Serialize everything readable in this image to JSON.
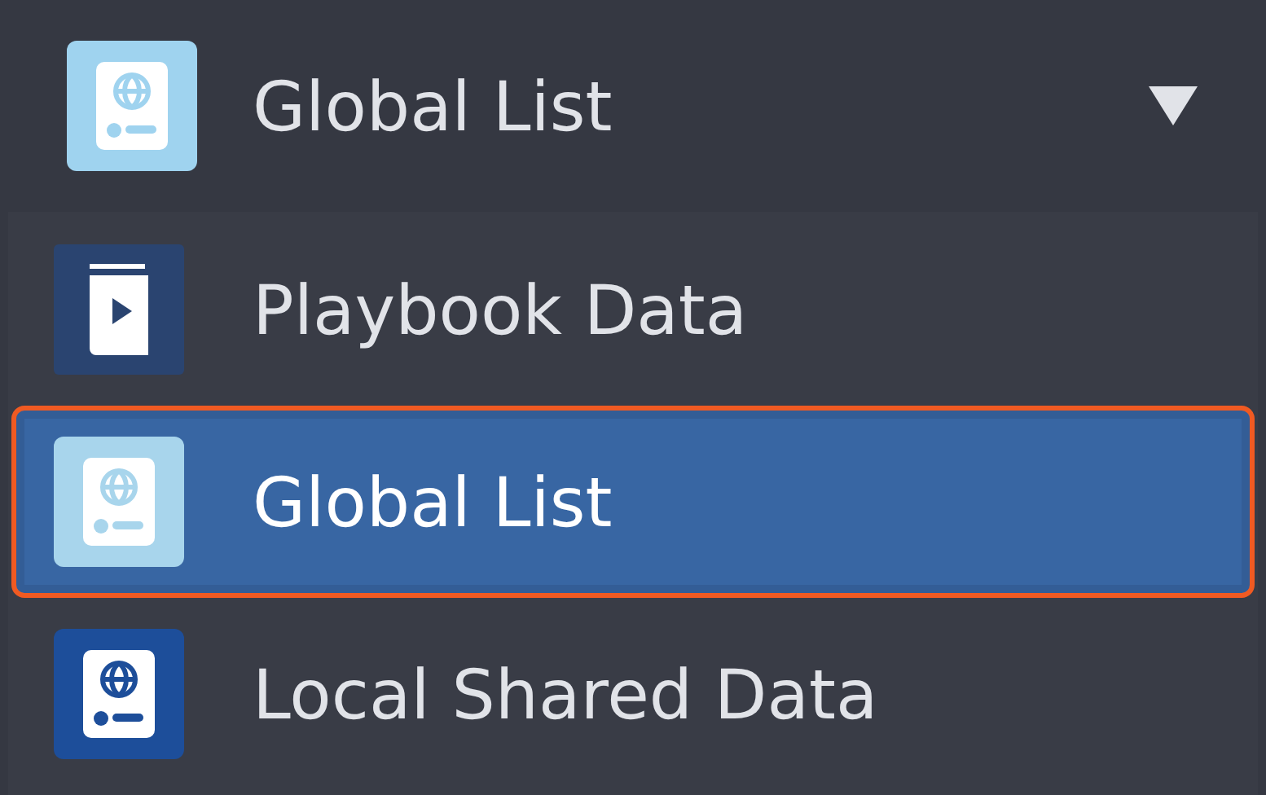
{
  "dropdown": {
    "value": "Global List",
    "icon": {
      "kind": "globe-card",
      "color": "#9fd3ef"
    },
    "expanded": true,
    "options": [
      {
        "label": "Playbook Data",
        "selected": false,
        "icon": {
          "kind": "book",
          "color": "#2a4470"
        }
      },
      {
        "label": "Global List",
        "selected": true,
        "icon": {
          "kind": "globe-card",
          "color": "#a8d5ec"
        }
      },
      {
        "label": "Local Shared Data",
        "selected": false,
        "icon": {
          "kind": "globe-card",
          "color": "#1d4e9a"
        }
      }
    ]
  }
}
